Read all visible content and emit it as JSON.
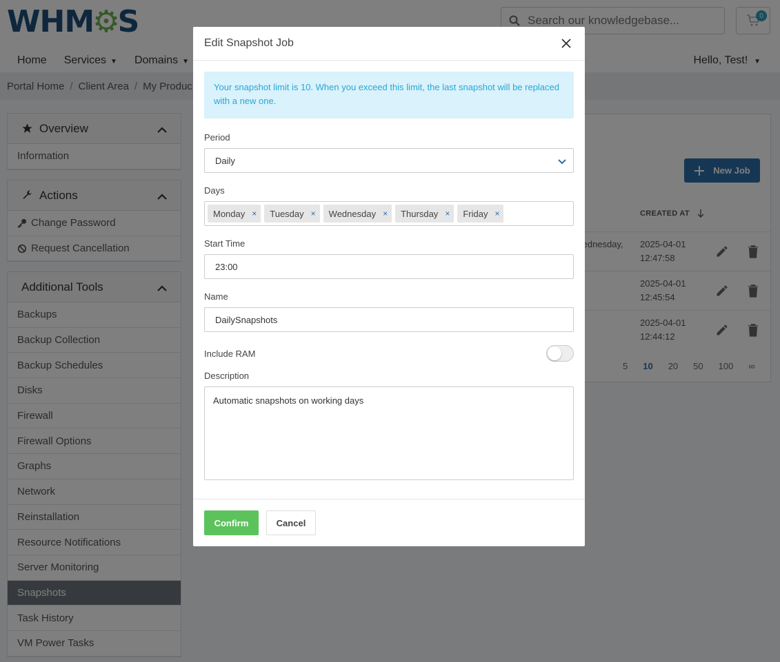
{
  "header": {
    "logo_text": "WHMCS",
    "search_placeholder": "Search our knowledgebase...",
    "cart_count": "0",
    "nav": [
      {
        "label": "Home"
      },
      {
        "label": "Services"
      },
      {
        "label": "Domains"
      }
    ],
    "greeting": "Hello, Test!"
  },
  "breadcrumb": [
    "Portal Home",
    "Client Area",
    "My Produc"
  ],
  "sidebar": {
    "overview": {
      "title": "Overview",
      "items": [
        "Information"
      ]
    },
    "actions": {
      "title": "Actions",
      "items": [
        "Change Password",
        "Request Cancellation"
      ]
    },
    "tools": {
      "title": "Additional Tools",
      "items": [
        "Backups",
        "Backup Collection",
        "Backup Schedules",
        "Disks",
        "Firewall",
        "Firewall Options",
        "Graphs",
        "Network",
        "Reinstallation",
        "Resource Notifications",
        "Server Monitoring",
        "Snapshots",
        "Task History",
        "VM Power Tasks"
      ],
      "active": "Snapshots"
    }
  },
  "jobs": {
    "new_job_label": "New Job",
    "created_at_header": "CREATED AT",
    "rows": [
      {
        "days_fragment": "/ednesday,",
        "date": "2025-04-01",
        "time": "12:47:58"
      },
      {
        "days_fragment": "",
        "date": "2025-04-01",
        "time": "12:45:54"
      },
      {
        "days_fragment": "",
        "date": "2025-04-01",
        "time": "12:44:12"
      }
    ],
    "page_sizes": [
      "5",
      "10",
      "20",
      "50",
      "100",
      "∞"
    ],
    "current_page_size": "10"
  },
  "modal": {
    "title": "Edit Snapshot Job",
    "alert": "Your snapshot limit is 10. When you exceed this limit, the last snapshot will be replaced with a new one.",
    "period_label": "Period",
    "period_value": "Daily",
    "days_label": "Days",
    "days": [
      "Monday",
      "Tuesday",
      "Wednesday",
      "Thursday",
      "Friday"
    ],
    "start_time_label": "Start Time",
    "start_time_value": "23:00",
    "name_label": "Name",
    "name_value": "DailySnapshots",
    "include_ram_label": "Include RAM",
    "include_ram_on": false,
    "description_label": "Description",
    "description_value": "Automatic snapshots on working days",
    "confirm_label": "Confirm",
    "cancel_label": "Cancel"
  },
  "colors": {
    "brand_blue": "#1e4f7a",
    "primary": "#2d6ea8",
    "success": "#5cc35c",
    "info_bg": "#d9f2fb",
    "info_text": "#2aa6d6"
  }
}
